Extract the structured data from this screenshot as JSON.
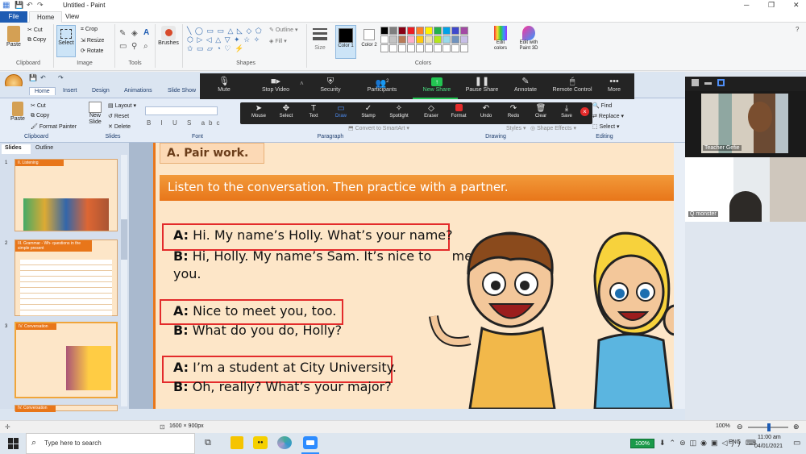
{
  "paint": {
    "title": "Untitled - Paint",
    "tabs": [
      "File",
      "Home",
      "View"
    ],
    "clipboard": {
      "paste": "Paste",
      "cut": "Cut",
      "copy": "Copy",
      "label": "Clipboard"
    },
    "image": {
      "select": "Select",
      "crop": "Crop",
      "resize": "Resize",
      "rotate": "Rotate",
      "label": "Image"
    },
    "tools": {
      "label": "Tools"
    },
    "brushes": {
      "label": "Brushes"
    },
    "shapes": {
      "outline": "Outline",
      "fill": "Fill",
      "label": "Shapes"
    },
    "size": {
      "label": "Size"
    },
    "color1": "Color 1",
    "color2": "Color 2",
    "edit_colors": "Edit colors",
    "edit_3d": "Edit with Paint 3D",
    "colors_label": "Colors",
    "status": {
      "size": "1600 × 900px",
      "zoom": "100%"
    }
  },
  "zoom": {
    "toolbar": [
      "Mute",
      "Stop Video",
      "Security",
      "Participants",
      "New Share",
      "Pause Share",
      "Annotate",
      "Remote Control",
      "More"
    ],
    "participants_count": "2",
    "annotate": [
      "Mouse",
      "Select",
      "Text",
      "Draw",
      "Stamp",
      "Spotlight",
      "Eraser",
      "Format",
      "Undo",
      "Redo",
      "Clear",
      "Save"
    ]
  },
  "ppt": {
    "tabs": [
      "Home",
      "Insert",
      "Design",
      "Animations",
      "Slide Show"
    ],
    "clipboard": {
      "paste": "Paste",
      "cut": "Cut",
      "copy": "Copy",
      "format_painter": "Format Painter",
      "label": "Clipboard"
    },
    "slides": {
      "new_slide": "New Slide",
      "layout": "Layout",
      "reset": "Reset",
      "delete": "Delete",
      "label": "Slides"
    },
    "font_label": "Font",
    "paragraph_label": "Paragraph",
    "convert": "Convert to SmartArt",
    "drawing_label": "Drawing",
    "styles": "Styles",
    "shape_effects": "Shape Effects",
    "editing": {
      "find": "Find",
      "replace": "Replace",
      "select": "Select",
      "label": "Editing"
    },
    "panel_tabs": [
      "Slides",
      "Outline"
    ],
    "thumbs": [
      {
        "num": "1",
        "title": "II. Listening"
      },
      {
        "num": "2",
        "title": "III. Grammar - Wh- questions in the simple present"
      },
      {
        "num": "3",
        "title": "IV. Conversation"
      },
      {
        "num": "4",
        "title": "IV. Conversation"
      }
    ]
  },
  "slide": {
    "heading": "A. Pair work.",
    "instruction": "Listen to the conversation.  Then practice with a partner.",
    "lines": [
      {
        "speaker": "A:",
        "text": "Hi. My name’s Holly. What’s your name?"
      },
      {
        "speaker": "B:",
        "text": "Hi, Holly. My name’s Sam. It’s nice to     meet"
      },
      {
        "speaker": "",
        "text": "you."
      },
      {
        "speaker": "A:",
        "text": "Nice to meet you, too."
      },
      {
        "speaker": "B:",
        "text": "What do you do, Holly?"
      },
      {
        "speaker": "A:",
        "text": "I’m a student at City University."
      },
      {
        "speaker": "B:",
        "text": "Oh, really? What’s your major?"
      }
    ]
  },
  "video": {
    "p1": "Teacher Gefie",
    "p2": "Q monster"
  },
  "taskbar": {
    "search": "Type here to search",
    "battery": "100%",
    "lang": "ENG",
    "time": "11:00 am",
    "date": "04/01/2021"
  },
  "colors": {
    "accent_orange": "#e8761a",
    "red_box": "#e32b2b",
    "zoom_green": "#23c552"
  }
}
